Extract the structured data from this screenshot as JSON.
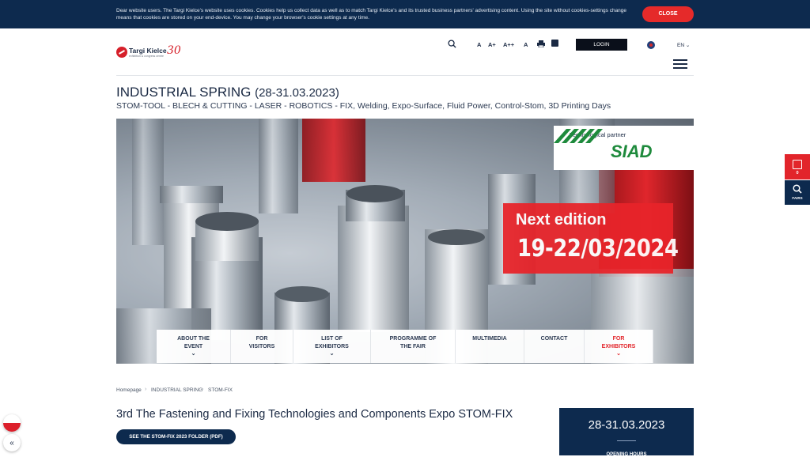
{
  "cookie": {
    "text": "Dear website users. The Targi Kielce's website uses cookies. Cookies help us collect data as well as to match Targi Kielce's and its trusted business partners' advertising content. Using the site without cookies-settings change means that cookies are stored on your end-device. You may change your browser's cookie settings at any time.",
    "close_label": "CLOSE"
  },
  "logo": {
    "name": "Targi Kielce",
    "tagline": "exhibition & congress centre",
    "anniversary": "30"
  },
  "toolbar": {
    "font_sizes": [
      "A",
      "A+",
      "A++",
      "A"
    ],
    "login_label": "LOGIN",
    "language": "EN"
  },
  "page": {
    "title": "INDUSTRIAL SPRING",
    "title_dates": "(28-31.03.2023)",
    "subtitle": "STOM-TOOL - BLECH & CUTTING - LASER - ROBOTICS - FIX, Welding, Expo-Surface, Fluid Power, Control-Stom, 3D Printing Days"
  },
  "hero": {
    "partner_label": "Technological partner",
    "partner_name": "SIAD",
    "next_label": "Next edition",
    "next_dates": "19-22/03/2024"
  },
  "menu": [
    {
      "line1": "ABOUT THE",
      "line2": "EVENT",
      "chevron": "⌄"
    },
    {
      "line1": "FOR",
      "line2": "VISITORS",
      "chevron": ""
    },
    {
      "line1": "LIST OF",
      "line2": "EXHIBITORS",
      "chevron": "⌄"
    },
    {
      "line1": "PROGRAMME OF",
      "line2": "THE FAIR",
      "chevron": ""
    },
    {
      "line1": "MULTIMEDIA",
      "line2": "",
      "chevron": ""
    },
    {
      "line1": "CONTACT",
      "line2": "",
      "chevron": ""
    },
    {
      "line1": "FOR",
      "line2": "EXHIBITORS",
      "chevron": "⌄"
    }
  ],
  "breadcrumb": [
    "Homepage",
    "INDUSTRIAL SPRING",
    "STOM-FIX"
  ],
  "content": {
    "heading": "3rd The Fastening and Fixing Technologies and Components Expo STOM-FIX",
    "pdf_button": "SEE THE STOM-FIX 2023 FOLDER (PDF)",
    "date_card": "28-31.03.2023",
    "date_card_footer": "OPENING HOURS"
  },
  "side": {
    "calendar_count": "0",
    "fairs_label": "FAIRS"
  },
  "colors": {
    "navy": "#0d2a4e",
    "accent_red": "#e2252b"
  },
  "icons": [
    "search-icon",
    "print-icon",
    "rss-icon",
    "flag-icon",
    "menu-icon",
    "calendar-icon",
    "chevron-left-double-icon"
  ]
}
